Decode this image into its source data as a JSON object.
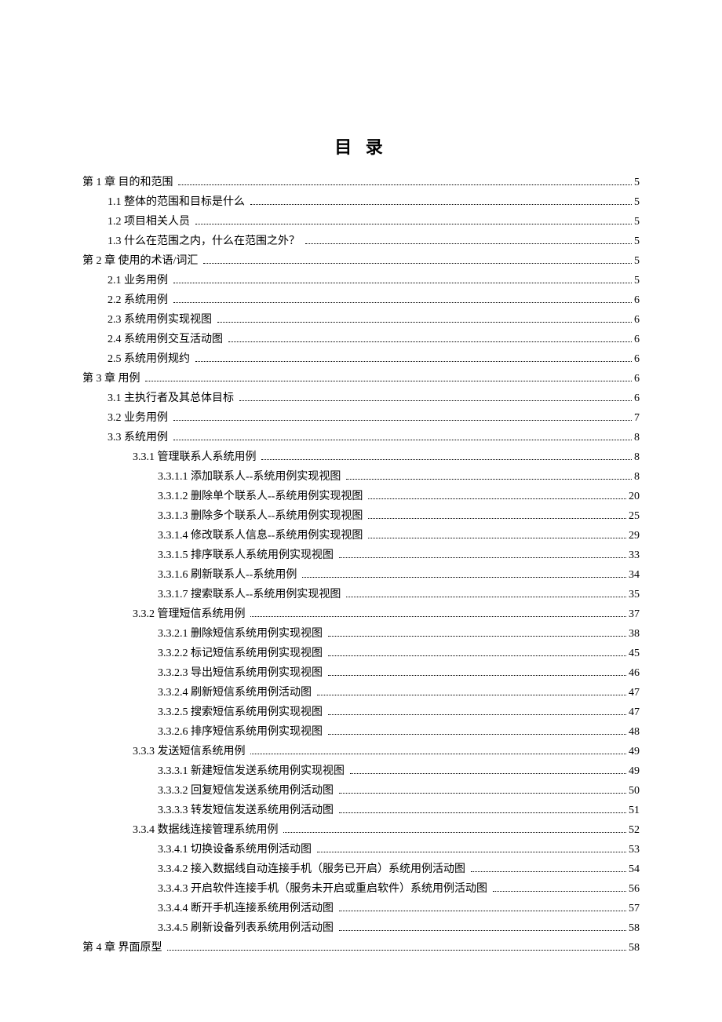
{
  "title": "目 录",
  "entries": [
    {
      "indent": 0,
      "label": "第 1 章 目的和范围",
      "page": "5"
    },
    {
      "indent": 1,
      "label": "1.1 整体的范围和目标是什么",
      "page": "5"
    },
    {
      "indent": 1,
      "label": "1.2 项目相关人员",
      "page": "5"
    },
    {
      "indent": 1,
      "label": "1.3 什么在范围之内，什么在范围之外？",
      "page": "5"
    },
    {
      "indent": 0,
      "label": "第 2 章 使用的术语/词汇",
      "page": "5"
    },
    {
      "indent": 1,
      "label": "2.1 业务用例",
      "page": "5"
    },
    {
      "indent": 1,
      "label": "2.2 系统用例",
      "page": "6"
    },
    {
      "indent": 1,
      "label": "2.3 系统用例实现视图",
      "page": "6"
    },
    {
      "indent": 1,
      "label": "2.4 系统用例交互活动图",
      "page": "6"
    },
    {
      "indent": 1,
      "label": "2.5 系统用例规约",
      "page": "6"
    },
    {
      "indent": 0,
      "label": "第 3 章 用例",
      "page": "6"
    },
    {
      "indent": 1,
      "label": "3.1 主执行者及其总体目标",
      "page": "6"
    },
    {
      "indent": 1,
      "label": "3.2 业务用例",
      "page": "7"
    },
    {
      "indent": 1,
      "label": "3.3 系统用例",
      "page": "8"
    },
    {
      "indent": 2,
      "label": "3.3.1 管理联系人系统用例",
      "page": "8"
    },
    {
      "indent": 3,
      "label": "3.3.1.1 添加联系人--系统用例实现视图",
      "page": "8"
    },
    {
      "indent": 3,
      "label": "3.3.1.2 删除单个联系人--系统用例实现视图",
      "page": "20"
    },
    {
      "indent": 3,
      "label": "3.3.1.3 删除多个联系人--系统用例实现视图",
      "page": "25"
    },
    {
      "indent": 3,
      "label": "3.3.1.4 修改联系人信息--系统用例实现视图",
      "page": "29"
    },
    {
      "indent": 3,
      "label": "3.3.1.5 排序联系人系统用例实现视图",
      "page": "33"
    },
    {
      "indent": 3,
      "label": "3.3.1.6 刷新联系人--系统用例",
      "page": "34"
    },
    {
      "indent": 3,
      "label": "3.3.1.7 搜索联系人--系统用例实现视图",
      "page": "35"
    },
    {
      "indent": 2,
      "label": "3.3.2 管理短信系统用例",
      "page": "37"
    },
    {
      "indent": 3,
      "label": "3.3.2.1 删除短信系统用例实现视图",
      "page": "38"
    },
    {
      "indent": 3,
      "label": "3.3.2.2 标记短信系统用例实现视图",
      "page": "45"
    },
    {
      "indent": 3,
      "label": "3.3.2.3 导出短信系统用例实现视图",
      "page": "46"
    },
    {
      "indent": 3,
      "label": "3.3.2.4 刷新短信系统用例活动图",
      "page": "47"
    },
    {
      "indent": 3,
      "label": "3.3.2.5 搜索短信系统用例实现视图",
      "page": "47"
    },
    {
      "indent": 3,
      "label": "3.3.2.6 排序短信系统用例实现视图",
      "page": "48"
    },
    {
      "indent": 2,
      "label": "3.3.3 发送短信系统用例",
      "page": "49"
    },
    {
      "indent": 3,
      "label": "3.3.3.1 新建短信发送系统用例实现视图",
      "page": "49"
    },
    {
      "indent": 3,
      "label": "3.3.3.2 回复短信发送系统用例活动图",
      "page": "50"
    },
    {
      "indent": 3,
      "label": "3.3.3.3 转发短信发送系统用例活动图",
      "page": "51"
    },
    {
      "indent": 2,
      "label": "3.3.4 数据线连接管理系统用例",
      "page": "52"
    },
    {
      "indent": 3,
      "label": "3.3.4.1 切换设备系统用例活动图",
      "page": "53"
    },
    {
      "indent": 3,
      "label": "3.3.4.2 接入数据线自动连接手机（服务已开启）系统用例活动图",
      "page": "54"
    },
    {
      "indent": 3,
      "label": "3.3.4.3 开启软件连接手机（服务未开启或重启软件）系统用例活动图",
      "page": "56"
    },
    {
      "indent": 3,
      "label": "3.3.4.4 断开手机连接系统用例活动图",
      "page": "57"
    },
    {
      "indent": 3,
      "label": "3.3.4.5 刷新设备列表系统用例活动图",
      "page": "58"
    },
    {
      "indent": 0,
      "label": "第 4 章 界面原型",
      "page": "58"
    }
  ]
}
